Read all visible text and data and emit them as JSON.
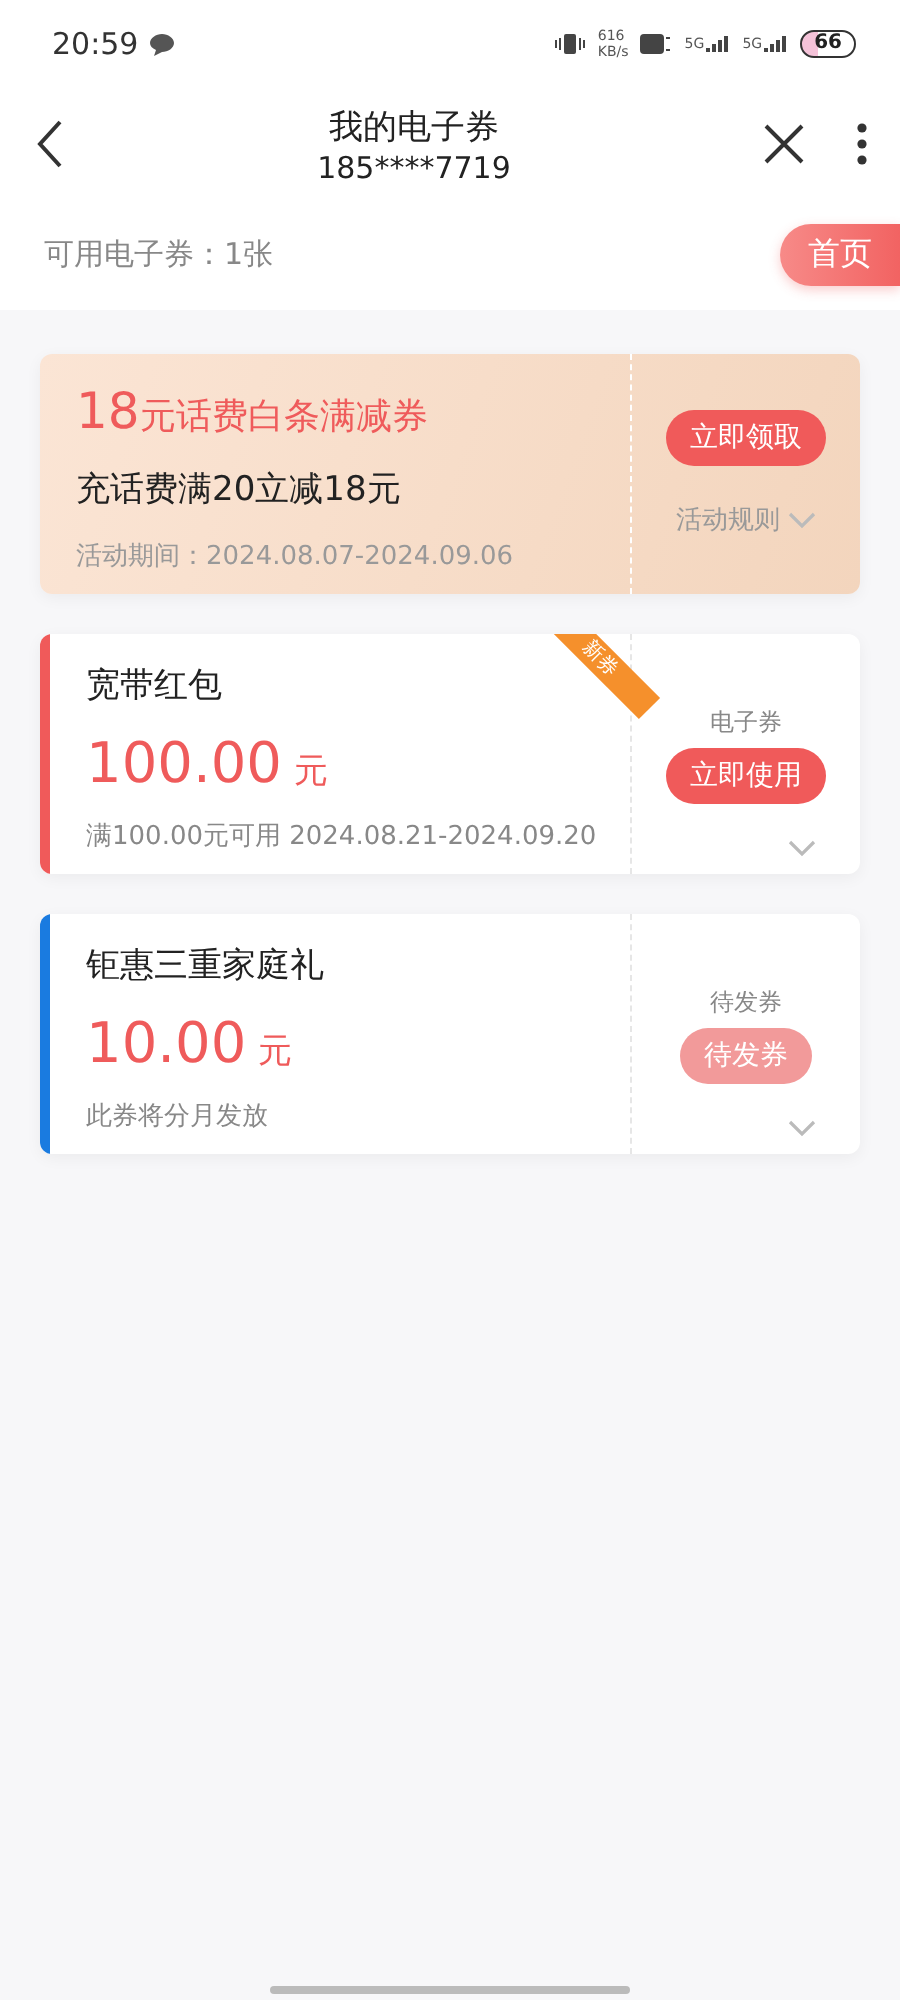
{
  "status_bar": {
    "time": "20:59",
    "speed": "616",
    "speed_unit": "KB/s",
    "networks": [
      "5G",
      "5G"
    ],
    "battery": "66"
  },
  "header": {
    "title": "我的电子券",
    "subtitle": "185****7719"
  },
  "summary": {
    "label": "可用电子券：1张",
    "home_button": "首页"
  },
  "promo": {
    "amount": "18",
    "title": "元话费白条满减券",
    "description": "充话费满20立减18元",
    "period": "活动期间：2024.08.07-2024.09.06",
    "button": "立即领取",
    "rules": "活动规则"
  },
  "coupons": [
    {
      "name": "宽带红包",
      "amount": "100.00",
      "unit": "元",
      "note": "满100.00元可用 2024.08.21-2024.09.20",
      "type_label": "电子券",
      "button": "立即使用",
      "disabled": false,
      "color": "#f05a5a",
      "badge": "新券"
    },
    {
      "name": "钜惠三重家庭礼",
      "amount": "10.00",
      "unit": "元",
      "note": "此券将分月发放",
      "type_label": "待发券",
      "button": "待发券",
      "disabled": true,
      "color": "#1a7be0"
    }
  ]
}
